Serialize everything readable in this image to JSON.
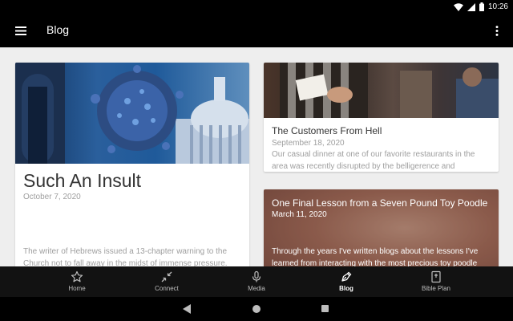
{
  "status_bar": {
    "time": "10:26"
  },
  "app_bar": {
    "title": "Blog"
  },
  "posts": [
    {
      "title": "Such An Insult",
      "date": "October 7, 2020",
      "excerpt": "The writer of Hebrews issued a 13-chapter warning to the Church not to fall away in the midst of immense pressure."
    },
    {
      "title": "The Customers From Hell",
      "date": "September 18, 2020",
      "excerpt": "Our casual dinner at one of our favorite restaurants in the area was recently disrupted by the belligerence and ceaseless"
    },
    {
      "title": "One Final Lesson from a Seven Pound Toy Poodle",
      "date": "March 11, 2020",
      "excerpt": "Through the years I've written blogs about the lessons I've learned from interacting with the most precious toy poodle"
    }
  ],
  "bottom_nav": {
    "items": [
      {
        "label": "Home",
        "icon": "star-icon"
      },
      {
        "label": "Connect",
        "icon": "compress-arrows-icon"
      },
      {
        "label": "Media",
        "icon": "microphone-icon"
      },
      {
        "label": "Blog",
        "icon": "pen-nib-icon"
      },
      {
        "label": "Bible Plan",
        "icon": "book-icon"
      }
    ],
    "active": "Blog"
  },
  "colors": {
    "app_bar": "#000000",
    "content_bg": "#eeeeee",
    "card_bg": "#ffffff",
    "title_text": "#333333",
    "meta_text": "#9e9e9e",
    "bottom_nav_bg": "#121212"
  }
}
